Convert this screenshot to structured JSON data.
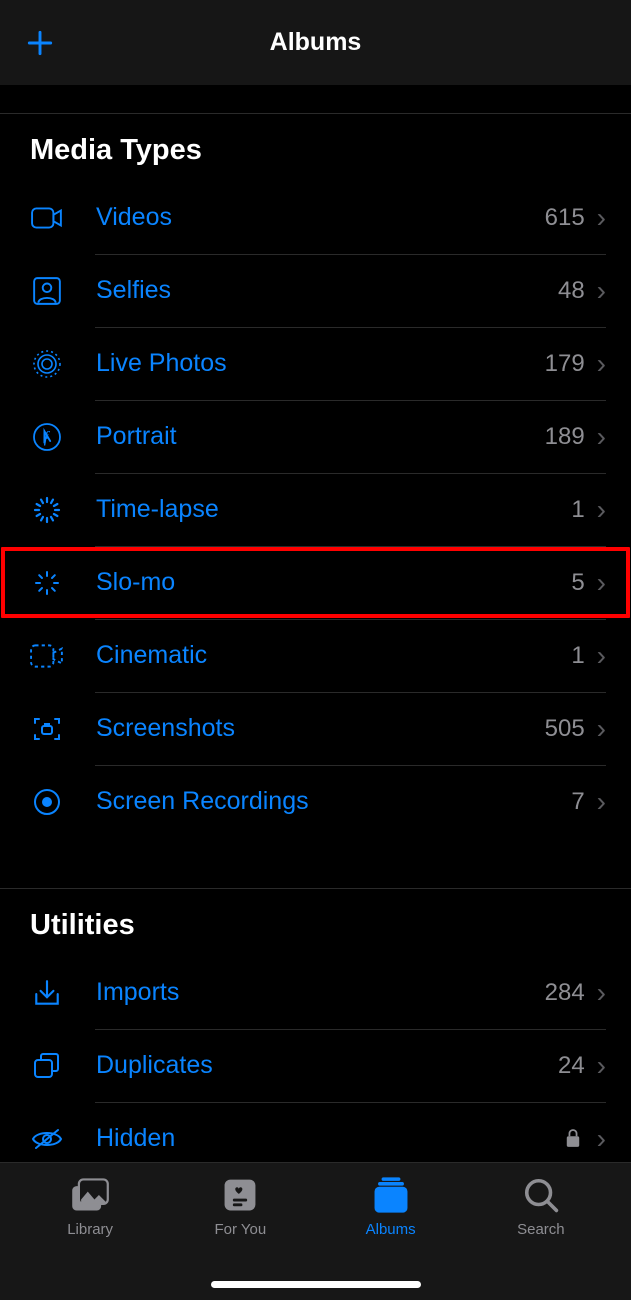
{
  "navbar": {
    "title": "Albums"
  },
  "sections": {
    "media_types": {
      "header": "Media Types",
      "items": [
        {
          "label": "Videos",
          "count": "615"
        },
        {
          "label": "Selfies",
          "count": "48"
        },
        {
          "label": "Live Photos",
          "count": "179"
        },
        {
          "label": "Portrait",
          "count": "189"
        },
        {
          "label": "Time-lapse",
          "count": "1"
        },
        {
          "label": "Slo-mo",
          "count": "5"
        },
        {
          "label": "Cinematic",
          "count": "1"
        },
        {
          "label": "Screenshots",
          "count": "505"
        },
        {
          "label": "Screen Recordings",
          "count": "7"
        }
      ]
    },
    "utilities": {
      "header": "Utilities",
      "items": [
        {
          "label": "Imports",
          "count": "284"
        },
        {
          "label": "Duplicates",
          "count": "24"
        },
        {
          "label": "Hidden",
          "locked": true
        }
      ]
    }
  },
  "tabs": {
    "library": "Library",
    "for_you": "For You",
    "albums": "Albums",
    "search": "Search"
  }
}
